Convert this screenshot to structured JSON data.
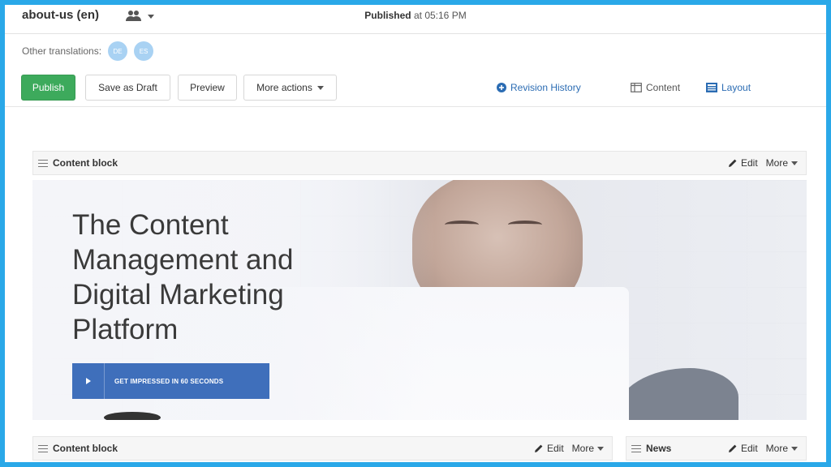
{
  "header": {
    "page_name": "about-us (en)",
    "status_label": "Published",
    "status_time": "at 05:16 PM"
  },
  "translations": {
    "label": "Other translations:",
    "languages": [
      "DE",
      "ES"
    ]
  },
  "toolbar": {
    "publish": "Publish",
    "save_draft": "Save as Draft",
    "preview": "Preview",
    "more_actions": "More actions",
    "revision_history": "Revision History",
    "content_view": "Content",
    "layout_view": "Layout"
  },
  "blocks": [
    {
      "title": "Content block",
      "edit": "Edit",
      "more": "More"
    },
    {
      "title": "Content block",
      "edit": "Edit",
      "more": "More"
    },
    {
      "title": "News",
      "edit": "Edit",
      "more": "More"
    }
  ],
  "hero": {
    "title": "The Content Management and Digital Marketing Platform",
    "cta": "GET IMPRESSED IN 60 SECONDS"
  },
  "icons": {
    "users": "users-icon",
    "revision": "plus-circle-icon",
    "content": "columns-icon",
    "layout": "layout-icon",
    "edit": "pencil-icon",
    "drag": "hamburger-icon",
    "play": "play-icon"
  },
  "colors": {
    "frame_border": "#2aa8e8",
    "publish_green": "#3daa5c",
    "link_blue": "#2b6cb3",
    "cta_blue": "#3f6fbb"
  }
}
